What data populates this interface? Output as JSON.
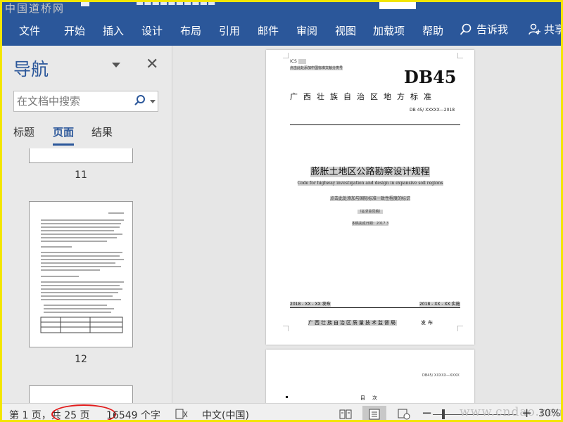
{
  "watermark_top": "中国道桥网",
  "watermark_bottom": "www.cndao.com",
  "ribbon": {
    "tabs": [
      "文件",
      "开始",
      "插入",
      "设计",
      "布局",
      "引用",
      "邮件",
      "审阅",
      "视图",
      "加载项",
      "帮助"
    ],
    "tell_me": "告诉我",
    "share": "共享"
  },
  "nav": {
    "title": "导航",
    "search_placeholder": "在文档中搜索",
    "tabs": [
      "标题",
      "页面",
      "结果"
    ],
    "active_tab": "页面",
    "thumbnails": [
      "11",
      "12"
    ]
  },
  "document": {
    "ics": "ICS",
    "ics_note": "点击此处添加中国标准文献分类号",
    "db_code": "DB45",
    "region": "广西壮族自治区地方标准",
    "std_code": "DB 45/ XXXXX—2018",
    "title_cn": "膨胀土地区公路勘察设计规程",
    "title_en": "Code for highway investigation and design in expansive soil regions",
    "consistency_note": "点击此处添加与国际标准一致性程度的标识",
    "draft_note": "（征求意见稿）",
    "completed": "本稿完成日期：2017.3",
    "publish_date": "2018 - XX - XX 发布",
    "implement_date": "2018 - XX - XX 实施",
    "issuer": "广西壮族自治区质量技术监督局",
    "issue_word": "发布",
    "page2_code": "DB45/ XXXXX—XXXX",
    "page2_toc": "目次"
  },
  "status": {
    "page": "第 1 页，共 25 页",
    "words": "16549 个字",
    "language": "中文(中国)",
    "zoom": "30%"
  },
  "colors": {
    "ribbon_blue": "#2b579a",
    "circle_red": "#e21b1b",
    "frame_yellow": "#f3e600"
  }
}
